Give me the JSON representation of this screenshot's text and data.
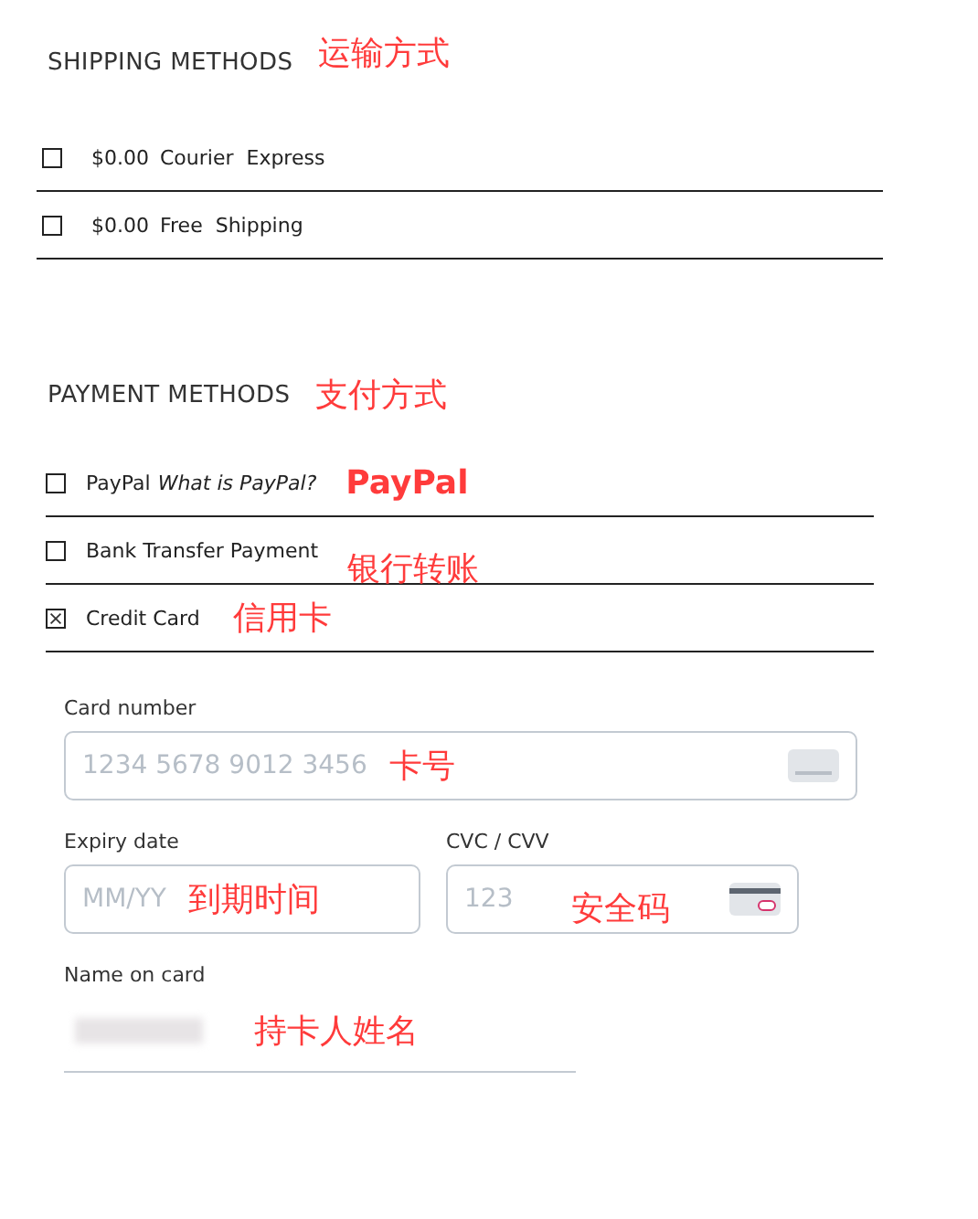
{
  "shipping": {
    "title": "SHIPPING METHODS",
    "note": "运输方式",
    "options": [
      {
        "price": "$0.00",
        "label": "Courier  Express",
        "checked": false
      },
      {
        "price": "$0.00",
        "label": "Free  Shipping",
        "checked": false
      }
    ]
  },
  "payment": {
    "title": "PAYMENT METHODS",
    "note": "支付方式",
    "options": [
      {
        "label": "PayPal",
        "link": "What is PayPal?",
        "note": "PayPal",
        "checked": false
      },
      {
        "label": "Bank Transfer Payment",
        "note": "银行转账",
        "checked": false
      },
      {
        "label": "Credit Card",
        "note": "信用卡",
        "checked": true
      }
    ]
  },
  "card_form": {
    "card_number": {
      "label": "Card number",
      "placeholder": "1234 5678 9012 3456",
      "note": "卡号"
    },
    "expiry": {
      "label": "Expiry date",
      "placeholder": "MM/YY",
      "note": "到期时间"
    },
    "cvc": {
      "label": "CVC / CVV",
      "placeholder": "123",
      "note": "安全码"
    },
    "name": {
      "label": "Name on card",
      "note": "持卡人姓名"
    }
  }
}
